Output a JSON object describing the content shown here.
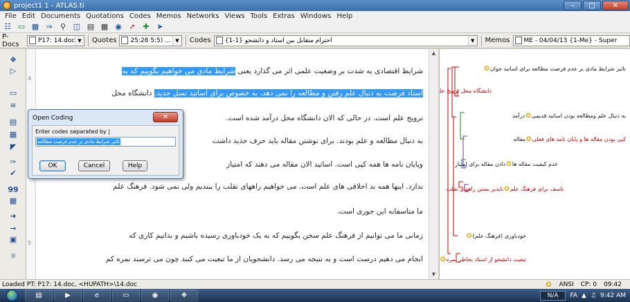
{
  "window": {
    "title": "project1 1 - ATLAS.ti"
  },
  "menu": [
    "File",
    "Edit",
    "Documents",
    "Quotations",
    "Codes",
    "Memos",
    "Networks",
    "Views",
    "Tools",
    "Extras",
    "Windows",
    "Help"
  ],
  "selectors": {
    "pdocs_label": "P-Docs",
    "pdocs_value": "P17: 14.doc",
    "quotes_label": "Quotes",
    "quotes_value": "25:28 5:5) ...",
    "codes_label": "Codes",
    "codes_value": "{احترام متقابل بین استاد و دانشجو {1-1",
    "memos_label": "Memos",
    "memos_value": "ME - 04/04/13 {1-Me} - Super"
  },
  "gutter": {
    "line_4": "4",
    "line_5": "5"
  },
  "document": {
    "line1_plain": "شرایط اقتصادی به شدت بر وضعیت علمی اثر می گذارد یعنی ",
    "line1_hl": "شرایط مادی می خواهیم بگوییم که به",
    "line2_hl": "استاد فرصت به دنبال علم رفتن و مطالعه را نمی دهد، به خصوص برای اساتید نسل جدید.",
    "line2_plain": " دانشگاه محل",
    "line3": "ترویج علم است. در حالی که الان دانشگاه محل درآمد شده است.",
    "line4": "به دنبال مطالعه و علم بودند. برای نوشتن مقاله باید حرف جدید داشت",
    "line5": "وپایان نامه ها همه کپی است. اساتید الان مقاله می دهند که امتیاز",
    "line6": "ندارد. اینها همه بد اخلاقی های علم است. می خواهیم راههای تقلب را ببندیم ولی نمی شود. فرهنگ علم",
    "line7": "ما متاسفانه این جوری است.",
    "line8": "زمانی ما می توانیم از فرهنگ علم سخن بگوییم که به یک خودباوری رسیده باشیم و بدانیم کاری که",
    "line9": "انجام می دهیم درست است و به نتیجه می رسد. دانشجویان از ما تبعیت می کنند چون می ترسند نمره کم"
  },
  "margin_codes": [
    "تاثیر شرایط مادی بر عدم فرصت مطالعه برای اساتید جوان",
    "دانشگاه محل ترویج علم",
    "به دنبال علم ومطالعه بودن اساتید قدیمی",
    "درآمد",
    "کپی بودن مقاله ها و پایان نامه های فعلی",
    "مقاله",
    "عدم کیفیت مقاله ها",
    "دادن مقاله برای امتیاز",
    "تاسف برای فرهنگ علم",
    "ناپذیر بستن راههای تقلب",
    "خودباوری (فرهنگ علم)",
    "تبعیت دانشجو از استاد بخاطر نمره"
  ],
  "dialog": {
    "title": "Open Coding",
    "prompt": "Enter codes separated by |",
    "input_value": "تاثیر شرایط مادی بر عدم فرصت مطالعه",
    "ok": "OK",
    "cancel": "Cancel",
    "help": "Help"
  },
  "status": {
    "left": "Loaded PT: P17: 14.doc, <HUPATH>\\14.doc",
    "encoding": "ANSI",
    "codepage": "CP: 0",
    "time": "09:42"
  },
  "taskbar": {
    "na": "N/A",
    "lang": "FA",
    "clock": "9:42 AM"
  }
}
